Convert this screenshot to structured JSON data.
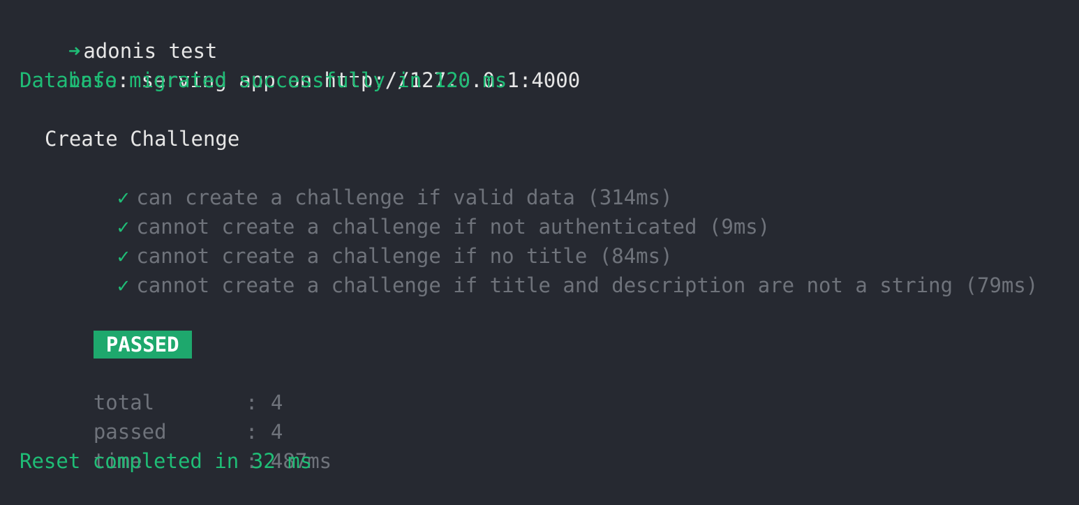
{
  "prompt": {
    "arrow_glyph": "➜",
    "command": "adonis test"
  },
  "info_line": {
    "tag": "info",
    "separator": ":",
    "message": " serving app on http://127.0.0.1:4000"
  },
  "migration_message": "Database migrated successfully in 120 ms",
  "suite": {
    "title": "Create Challenge",
    "check_glyph": "✓",
    "tests": [
      "can create a challenge if valid data (314ms)",
      "cannot create a challenge if not authenticated (9ms)",
      "cannot create a challenge if no title (84ms)",
      "cannot create a challenge if title and description are not a string (79ms)"
    ]
  },
  "status_badge": "PASSED",
  "summary": {
    "separator": ":",
    "rows": [
      {
        "key": "total",
        "value": "4"
      },
      {
        "key": "passed",
        "value": "4"
      },
      {
        "key": "time",
        "value": "487ms"
      }
    ]
  },
  "reset_message": "Reset completed in 32 ms",
  "colors": {
    "background": "#262931",
    "accent_green": "#1fbd76",
    "badge_green": "#1ea86d",
    "text_white": "#e6e6e6",
    "text_gray": "#6f737b"
  }
}
